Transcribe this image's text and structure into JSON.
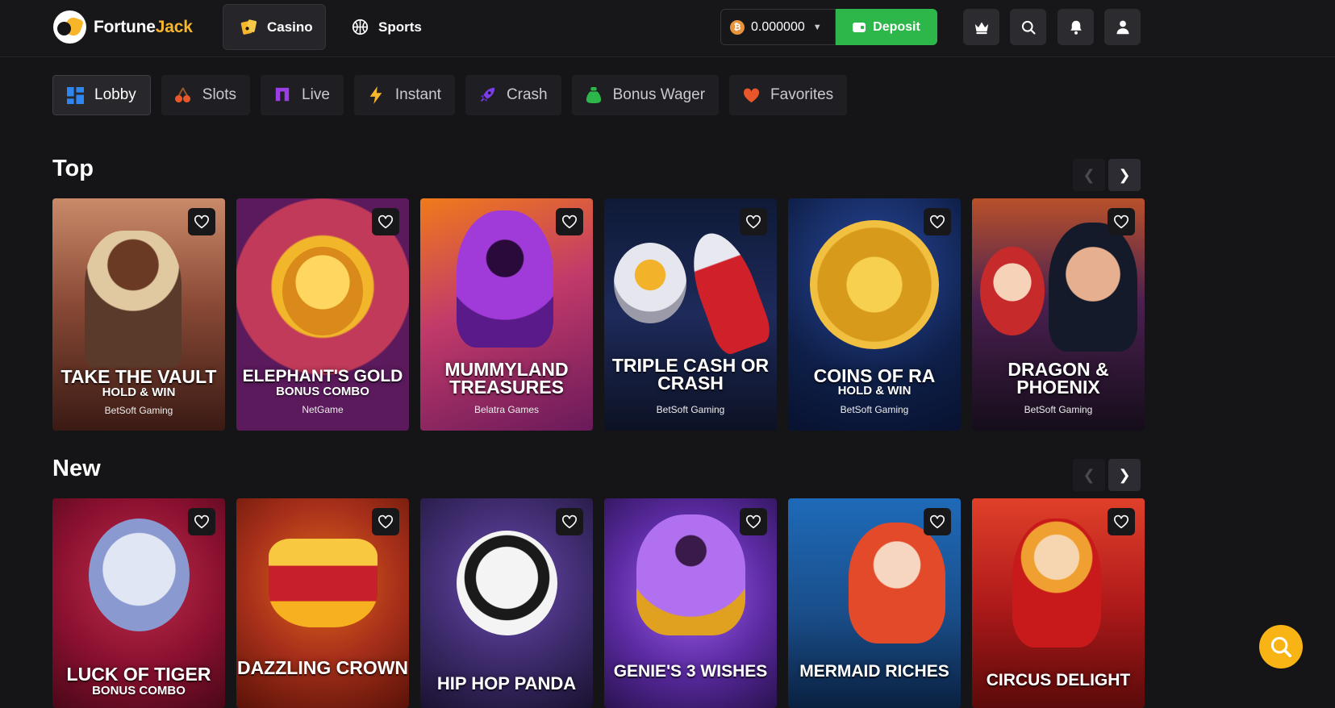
{
  "brand": {
    "name_part1": "Fortune",
    "name_part2": "Jack"
  },
  "nav": {
    "casino": "Casino",
    "sports": "Sports"
  },
  "wallet": {
    "balance": "0.000000",
    "currency_icon": "bitcoin-icon",
    "deposit_label": "Deposit"
  },
  "header_icons": [
    "crown-icon",
    "search-icon",
    "bell-icon",
    "user-icon"
  ],
  "categories": [
    {
      "label": "Lobby",
      "icon": "grid-icon"
    },
    {
      "label": "Slots",
      "icon": "cherry-icon"
    },
    {
      "label": "Live",
      "icon": "live-icon"
    },
    {
      "label": "Instant",
      "icon": "lightning-icon"
    },
    {
      "label": "Crash",
      "icon": "rocket-icon"
    },
    {
      "label": "Bonus Wager",
      "icon": "money-bag-icon"
    },
    {
      "label": "Favorites",
      "icon": "heart-icon"
    }
  ],
  "sections": {
    "top": {
      "title": "Top",
      "games": [
        {
          "title": "TAKE THE VAULT",
          "subtitle": "HOLD & WIN",
          "provider": "BetSoft Gaming",
          "bg": "#8a4a36"
        },
        {
          "title": "ELEPHANT'S GOLD",
          "subtitle": "BONUS COMBO",
          "provider": "NetGame",
          "bg": "#5a1a5c"
        },
        {
          "title": "MUMMYLAND TREASURES",
          "subtitle": "",
          "provider": "Belatra Games",
          "bg": "#9a2a6a"
        },
        {
          "title": "TRIPLE CASH OR CRASH",
          "subtitle": "",
          "provider": "BetSoft Gaming",
          "bg": "#152038"
        },
        {
          "title": "COINS OF RA",
          "subtitle": "HOLD & WIN",
          "provider": "BetSoft Gaming",
          "bg": "#0e1f48"
        },
        {
          "title": "DRAGON & PHOENIX",
          "subtitle": "",
          "provider": "BetSoft Gaming",
          "bg": "#3a1c40"
        }
      ]
    },
    "new": {
      "title": "New",
      "games": [
        {
          "title": "LUCK OF TIGER",
          "subtitle": "BONUS COMBO",
          "provider": "",
          "bg": "#8a1030"
        },
        {
          "title": "DAZZLING CROWN",
          "subtitle": "",
          "provider": "",
          "bg": "#8a2410"
        },
        {
          "title": "HIP HOP PANDA",
          "subtitle": "",
          "provider": "",
          "bg": "#3c2a6a"
        },
        {
          "title": "GENIE'S 3 WISHES",
          "subtitle": "",
          "provider": "",
          "bg": "#5a2aa0"
        },
        {
          "title": "MERMAID RICHES",
          "subtitle": "",
          "provider": "",
          "bg": "#1a4e8a"
        },
        {
          "title": "CIRCUS DELIGHT",
          "subtitle": "",
          "provider": "",
          "bg": "#b01a1a"
        }
      ]
    }
  },
  "colors": {
    "accent_gold": "#f7b52a",
    "deposit_green": "#2db74b",
    "background": "#151518",
    "fab": "#f8b415"
  }
}
